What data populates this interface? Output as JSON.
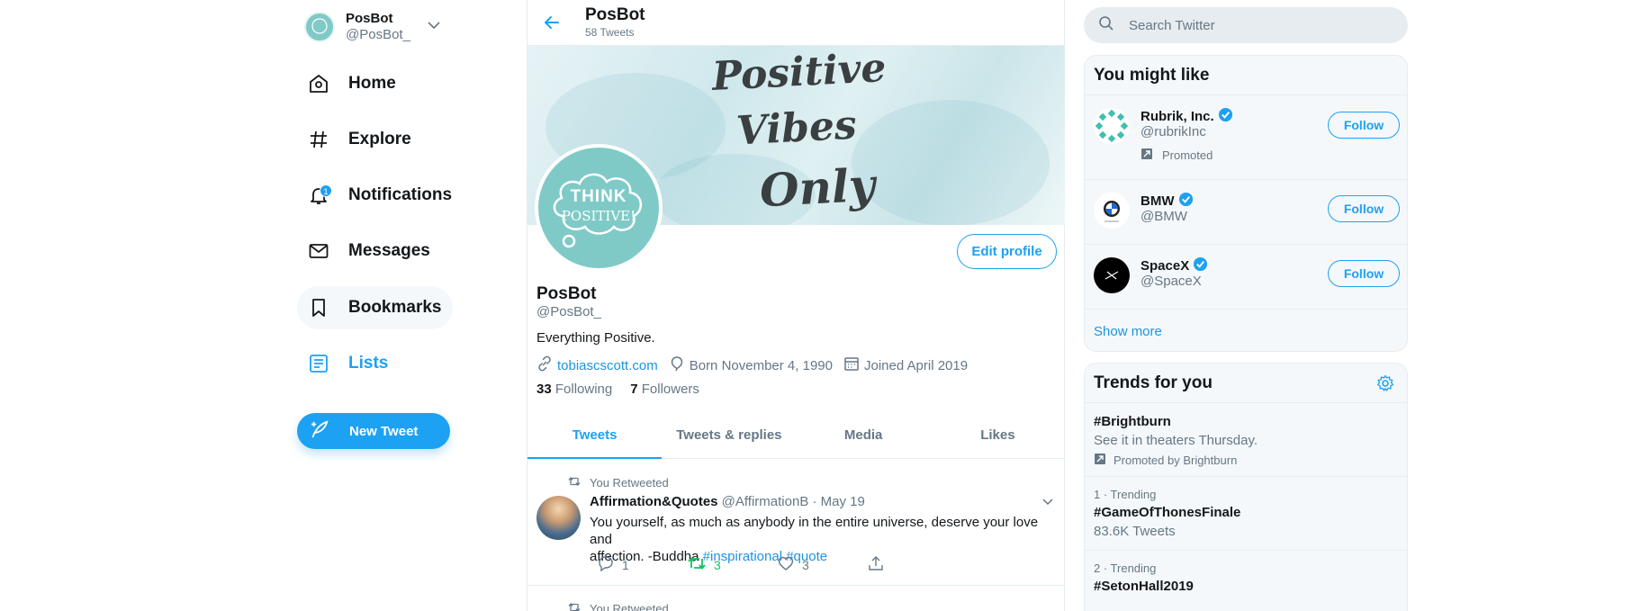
{
  "account": {
    "name": "PosBot",
    "handle": "@PosBot_"
  },
  "nav": {
    "items": [
      {
        "label": "Home",
        "icon": "home-icon"
      },
      {
        "label": "Explore",
        "icon": "hashtag-icon"
      },
      {
        "label": "Notifications",
        "icon": "bell-icon",
        "badge": "1"
      },
      {
        "label": "Messages",
        "icon": "envelope-icon"
      },
      {
        "label": "Bookmarks",
        "icon": "bookmark-icon"
      },
      {
        "label": "Lists",
        "icon": "list-icon"
      }
    ],
    "new_tweet": "New Tweet"
  },
  "header": {
    "title": "PosBot",
    "subtitle": "58 Tweets"
  },
  "banner": {
    "line1": "Positive",
    "line2": "Vibes",
    "line3": "Only"
  },
  "avatar": {
    "line1": "THINK",
    "line2": "POSITIVE!"
  },
  "profile": {
    "edit_label": "Edit profile",
    "name": "PosBot",
    "handle": "@PosBot_",
    "bio": "Everything Positive.",
    "website": "tobiascscott.com",
    "birthday": "Born November 4, 1990",
    "joined": "Joined April 2019",
    "following_count": "33",
    "following_label": "Following",
    "followers_count": "7",
    "followers_label": "Followers"
  },
  "tabs": [
    {
      "label": "Tweets"
    },
    {
      "label": "Tweets & replies"
    },
    {
      "label": "Media"
    },
    {
      "label": "Likes"
    }
  ],
  "tweets": [
    {
      "retweet_label": "You Retweeted",
      "author": "Affirmation&Quotes",
      "handle": "@AffirmationB",
      "separator": "·",
      "date": "May 19",
      "text_line1": "You yourself, as much as anybody in the entire universe, deserve your love and",
      "text_line2": "affection. -Buddha",
      "tag1": "#inspirational",
      "tag2": "#quote",
      "replies": "1",
      "retweets": "3",
      "likes": "3"
    },
    {
      "retweet_label": "You Retweeted"
    }
  ],
  "search": {
    "placeholder": "Search Twitter"
  },
  "who_to_follow": {
    "title": "You might like",
    "items": [
      {
        "name": "Rubrik, Inc.",
        "handle": "@rubrikInc",
        "promoted": "Promoted",
        "follow": "Follow"
      },
      {
        "name": "BMW",
        "handle": "@BMW",
        "follow": "Follow"
      },
      {
        "name": "SpaceX",
        "handle": "@SpaceX",
        "follow": "Follow"
      }
    ],
    "show_more": "Show more"
  },
  "trends": {
    "title": "Trends for you",
    "items": [
      {
        "name": "#Brightburn",
        "desc": "See it in theaters Thursday.",
        "promoted": "Promoted by Brightburn"
      },
      {
        "meta": "1 · Trending",
        "name": "#GameOfThonesFinale",
        "count": "83.6K Tweets"
      },
      {
        "meta": "2 · Trending",
        "name": "#SetonHall2019"
      }
    ]
  },
  "colors": {
    "accent": "#1da1f2",
    "text": "#14171a",
    "muted": "#657786",
    "retweet_green": "#17bf63",
    "border": "#e6ecf0"
  }
}
